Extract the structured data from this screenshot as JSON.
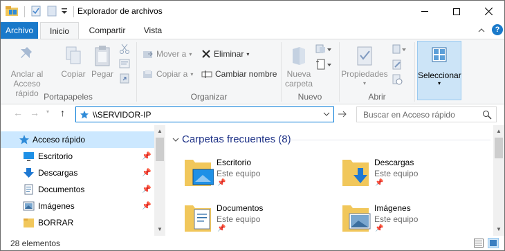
{
  "window": {
    "title": "Explorador de archivos"
  },
  "tabs": [
    {
      "label": "Archivo"
    },
    {
      "label": "Inicio"
    },
    {
      "label": "Compartir"
    },
    {
      "label": "Vista"
    }
  ],
  "ribbon": {
    "portapapeles": {
      "group_label": "Portapapeles",
      "pin_label_1": "Anclar al",
      "pin_label_2": "Acceso rápido",
      "copy_label": "Copiar",
      "paste_label": "Pegar"
    },
    "organizar": {
      "group_label": "Organizar",
      "move_label": "Mover a",
      "copy_to_label": "Copiar a",
      "delete_label": "Eliminar",
      "rename_label": "Cambiar nombre"
    },
    "nuevo": {
      "group_label": "Nuevo",
      "new_folder_1": "Nueva",
      "new_folder_2": "carpeta"
    },
    "abrir": {
      "group_label": "Abrir",
      "properties_label": "Propiedades"
    },
    "seleccionar": {
      "label": "Seleccionar"
    }
  },
  "address": {
    "path": "\\\\SERVIDOR-IP"
  },
  "search": {
    "placeholder": "Buscar en Acceso rápido"
  },
  "nav": {
    "items": [
      {
        "label": "Acceso rápido",
        "icon": "star-icon",
        "pinned": false
      },
      {
        "label": "Escritorio",
        "icon": "desktop-icon",
        "pinned": true
      },
      {
        "label": "Descargas",
        "icon": "download-icon",
        "pinned": true
      },
      {
        "label": "Documentos",
        "icon": "documents-icon",
        "pinned": true
      },
      {
        "label": "Imágenes",
        "icon": "pictures-icon",
        "pinned": true
      },
      {
        "label": "BORRAR",
        "icon": "folder-icon",
        "pinned": false
      }
    ]
  },
  "content": {
    "group_title": "Carpetas frecuentes (8)",
    "tiles": [
      {
        "name": "Escritorio",
        "sub": "Este equipo"
      },
      {
        "name": "Descargas",
        "sub": "Este equipo"
      },
      {
        "name": "Documentos",
        "sub": "Este equipo"
      },
      {
        "name": "Imágenes",
        "sub": "Este equipo"
      }
    ]
  },
  "status": {
    "count": "28 elementos"
  },
  "colors": {
    "accent": "#1979ca",
    "folder": "#f1c75b",
    "selection": "#cce8ff"
  }
}
